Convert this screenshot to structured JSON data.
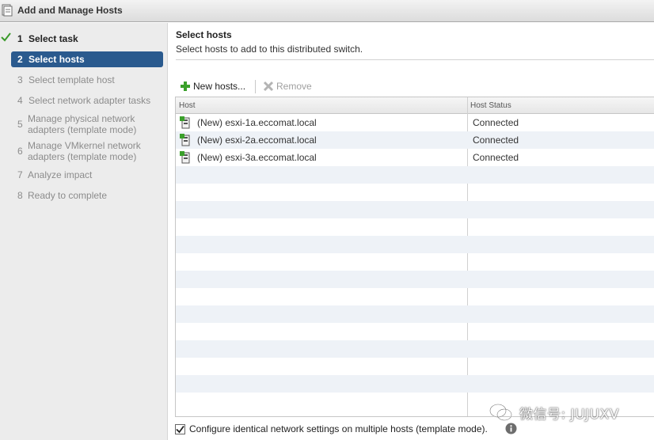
{
  "window": {
    "title": "Add and Manage Hosts"
  },
  "wizard": {
    "steps": [
      {
        "num": "1",
        "label": "Select task",
        "state": "done"
      },
      {
        "num": "2",
        "label": "Select hosts",
        "state": "active"
      },
      {
        "num": "3",
        "label": "Select template host",
        "state": "future"
      },
      {
        "num": "4",
        "label": "Select network adapter tasks",
        "state": "future"
      },
      {
        "num": "5",
        "label_line1": "Manage physical network",
        "label_line2": "adapters (template mode)",
        "state": "future"
      },
      {
        "num": "6",
        "label_line1": "Manage VMkernel network",
        "label_line2": "adapters (template mode)",
        "state": "future"
      },
      {
        "num": "7",
        "label": "Analyze impact",
        "state": "future"
      },
      {
        "num": "8",
        "label": "Ready to complete",
        "state": "future"
      }
    ]
  },
  "main": {
    "heading": "Select hosts",
    "subheading": "Select hosts to add to this distributed switch.",
    "toolbar": {
      "new_hosts_label": "New hosts...",
      "remove_label": "Remove"
    },
    "grid": {
      "columns": [
        "Host",
        "Host Status"
      ],
      "rows": [
        {
          "host": "(New) esxi-1a.eccomat.local",
          "status": "Connected"
        },
        {
          "host": "(New) esxi-2a.eccomat.local",
          "status": "Connected"
        },
        {
          "host": "(New) esxi-3a.eccomat.local",
          "status": "Connected"
        }
      ]
    },
    "template_mode_checkbox": {
      "label": "Configure identical network settings on multiple hosts (template mode).",
      "checked": true
    }
  },
  "watermark": {
    "text": "微信号: JUJUXV"
  },
  "colors": {
    "active_step": "#2a5a8e",
    "check_green": "#3a9a2a",
    "alt_row": "#eef2f7"
  },
  "icons": [
    "wizard-window-icon",
    "checkmark-icon",
    "add-plus-icon",
    "remove-x-icon",
    "host-icon",
    "info-icon",
    "wechat-icon"
  ]
}
